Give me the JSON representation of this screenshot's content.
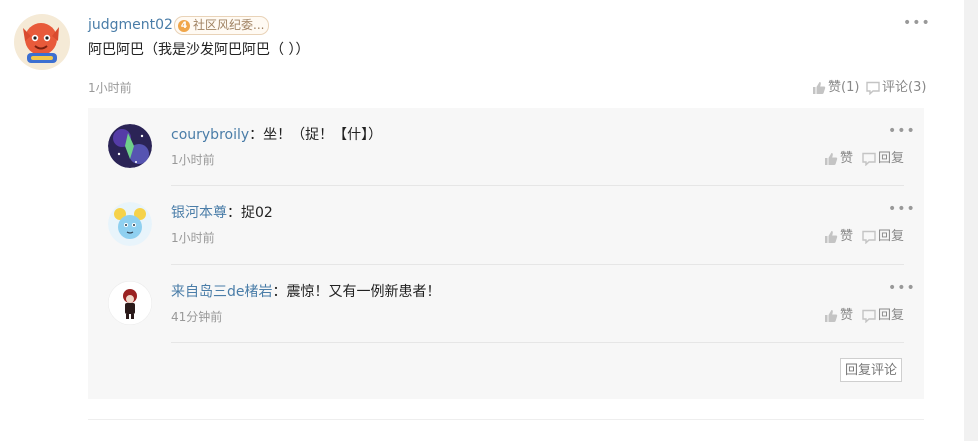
{
  "main_comment": {
    "username": "judgment02",
    "badge_level": "4",
    "badge_label": "社区风纪委...",
    "text": "阿巴阿巴（我是沙发阿巴阿巴（ ））",
    "time": "1小时前",
    "like_label": "赞(1)",
    "comment_label": "评论(3)",
    "more_icon": "•••"
  },
  "replies": [
    {
      "username": "courybroily",
      "content": "：坐！（捉！【什】）",
      "time": "1小时前",
      "like_label": "赞",
      "reply_label": "回复"
    },
    {
      "username": "银河本尊",
      "content": "：捉02",
      "time": "1小时前",
      "like_label": "赞",
      "reply_label": "回复"
    },
    {
      "username": "来自岛三de楮岩",
      "content": "：震惊！又有一例新患者！",
      "time": "41分钟前",
      "like_label": "赞",
      "reply_label": "回复"
    }
  ],
  "reply_more_icon": "•••",
  "reply_comment_button": "回复评论",
  "colors": {
    "username": "#4a7da8",
    "text": "#222222",
    "muted": "#999999",
    "reply_bg": "#f7f7f7"
  }
}
